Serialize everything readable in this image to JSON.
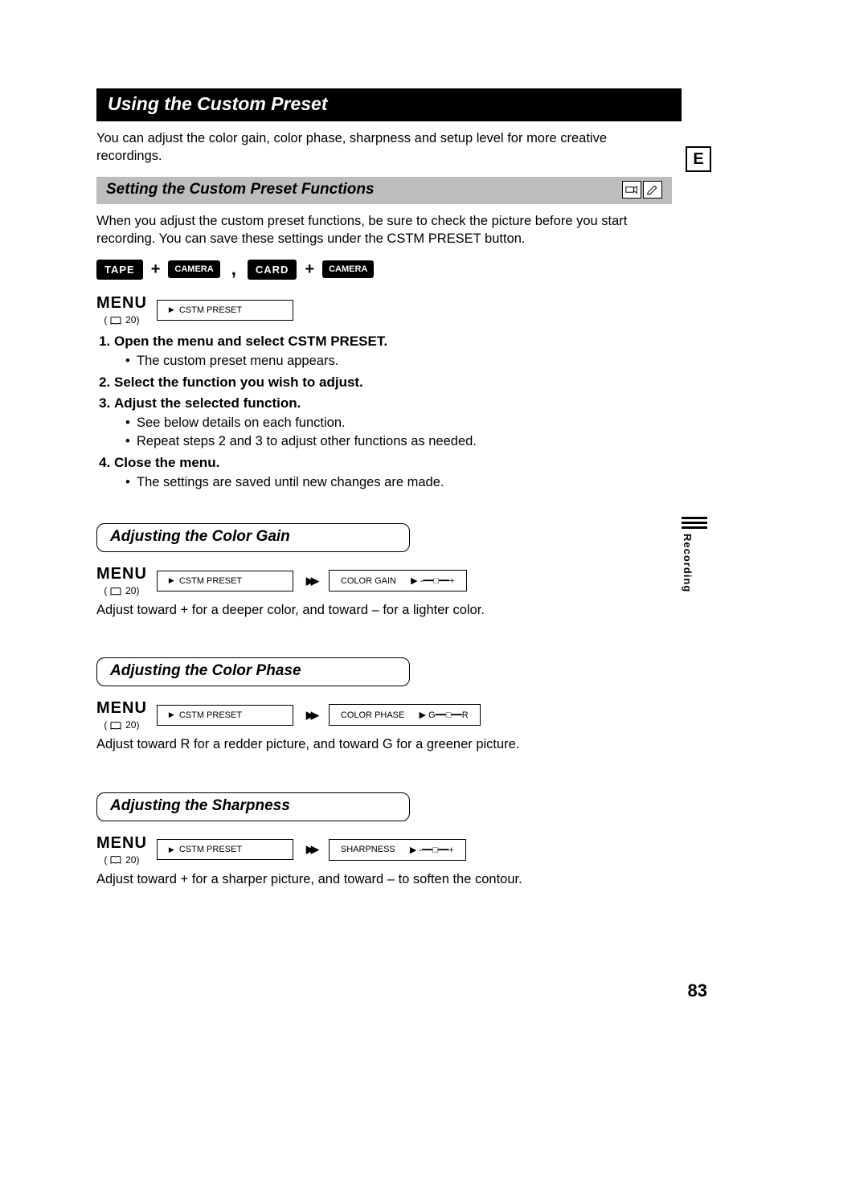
{
  "lang_marker": "E",
  "main_title": "Using the Custom Preset",
  "intro": "You can adjust the color gain, color phase, sharpness and setup level for more creative recordings.",
  "section1": {
    "heading": "Setting the Custom Preset Functions",
    "body": "When you adjust the custom preset functions, be sure to check the picture before you start recording. You can save these settings under the CSTM PRESET button."
  },
  "modes": {
    "tape": "TAPE",
    "card": "CARD",
    "camera": "CAMERA"
  },
  "menu": {
    "word": "MENU",
    "ref": " 20)"
  },
  "menu_path": {
    "item1": "CSTM PRESET"
  },
  "steps": {
    "s1": "Open the menu and select CSTM PRESET.",
    "s1_a": "The custom preset menu appears.",
    "s2": "Select the function you wish to adjust.",
    "s3": "Adjust the selected function.",
    "s3_a": "See below details on each function.",
    "s3_b": "Repeat steps 2 and 3 to adjust other functions as needed.",
    "s4": "Close the menu.",
    "s4_a": "The settings are saved until new changes are made."
  },
  "adjust": {
    "color_gain": {
      "heading": "Adjusting the Color Gain",
      "param": "COLOR GAIN",
      "slider_left": "-",
      "slider_right": "+",
      "desc": "Adjust toward + for a deeper color, and toward – for a lighter color."
    },
    "color_phase": {
      "heading": "Adjusting the Color Phase",
      "param": "COLOR PHASE",
      "slider_left": "G",
      "slider_right": "R",
      "desc": "Adjust toward R for a redder picture, and toward G for a greener picture."
    },
    "sharpness": {
      "heading": "Adjusting the Sharpness",
      "param": "SHARPNESS",
      "slider_left": "-",
      "slider_right": "+",
      "desc": "Adjust toward + for a sharper picture, and toward – to soften the contour."
    }
  },
  "side_label": "Recording",
  "page_number": "83"
}
